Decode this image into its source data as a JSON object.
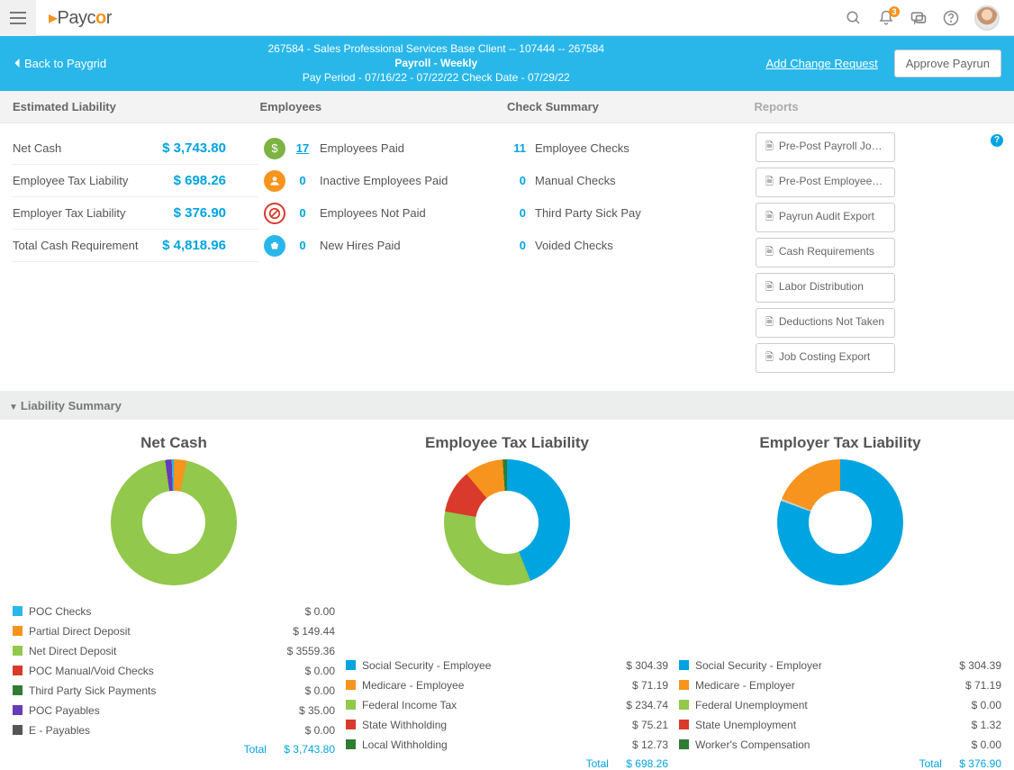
{
  "topbar": {
    "logo": "Paycor",
    "notifications_badge": "3"
  },
  "banner": {
    "back_label": "Back to Paygrid",
    "line1": "267584 - Sales Professional Services Base Client -- 107444 -- 267584",
    "line2": "Payroll - Weekly",
    "line3": "Pay Period - 07/16/22 - 07/22/22    Check Date - 07/29/22",
    "change_request": "Add Change Request",
    "approve": "Approve Payrun"
  },
  "headers": {
    "est": "Estimated Liability",
    "emp": "Employees",
    "chk": "Check Summary",
    "rep": "Reports"
  },
  "est_liability": [
    {
      "label": "Net Cash",
      "value": "$ 3,743.80"
    },
    {
      "label": "Employee Tax Liability",
      "value": "$ 698.26"
    },
    {
      "label": "Employer Tax Liability",
      "value": "$ 376.90"
    },
    {
      "label": "Total Cash Requirement",
      "value": "$ 4,818.96"
    }
  ],
  "employees": [
    {
      "num": "17",
      "label": "Employees Paid",
      "link": true
    },
    {
      "num": "0",
      "label": "Inactive Employees Paid",
      "link": false
    },
    {
      "num": "0",
      "label": "Employees Not Paid",
      "link": false
    },
    {
      "num": "0",
      "label": "New Hires Paid",
      "link": false
    }
  ],
  "check_summary": [
    {
      "num": "11",
      "label": "Employee Checks"
    },
    {
      "num": "0",
      "label": "Manual Checks"
    },
    {
      "num": "0",
      "label": "Third Party Sick Pay"
    },
    {
      "num": "0",
      "label": "Voided Checks"
    }
  ],
  "reports": [
    "Pre-Post Payroll Journal",
    "Pre-Post Employee Exp...",
    "Payrun Audit Export",
    "Cash Requirements",
    "Labor Distribution",
    "Deductions Not Taken",
    "Job Costing Export"
  ],
  "liability_summary_label": "Liability Summary",
  "chart_data": [
    {
      "type": "pie",
      "title": "Net Cash",
      "series": [
        {
          "name": "POC Checks",
          "value": 0.0,
          "color": "#29b7ea"
        },
        {
          "name": "Partial Direct Deposit",
          "value": 149.44,
          "color": "#f7941d"
        },
        {
          "name": "Net Direct Deposit",
          "value": 3559.36,
          "color": "#92c84b"
        },
        {
          "name": "POC Manual/Void Checks",
          "value": 0.0,
          "color": "#d93a2b"
        },
        {
          "name": "Third Party Sick Payments",
          "value": 0.0,
          "color": "#2e7d32"
        },
        {
          "name": "POC Payables",
          "value": 35.0,
          "color": "#673ab7"
        },
        {
          "name": "E - Payables",
          "value": 0.0,
          "color": "#555555"
        }
      ],
      "total_label": "Total",
      "total_value": "$ 3,743.80"
    },
    {
      "type": "pie",
      "title": "Employee Tax Liability",
      "series": [
        {
          "name": "Social Security - Employee",
          "value": 304.39,
          "color": "#00a4e0"
        },
        {
          "name": "Medicare - Employee",
          "value": 71.19,
          "color": "#f7941d"
        },
        {
          "name": "Federal Income Tax",
          "value": 234.74,
          "color": "#92c84b"
        },
        {
          "name": "State Withholding",
          "value": 75.21,
          "color": "#d93a2b"
        },
        {
          "name": "Local Withholding",
          "value": 12.73,
          "color": "#2e7d32"
        }
      ],
      "total_label": "Total",
      "total_value": "$ 698.26"
    },
    {
      "type": "pie",
      "title": "Employer Tax Liability",
      "series": [
        {
          "name": "Social Security - Employer",
          "value": 304.39,
          "color": "#00a4e0"
        },
        {
          "name": "Medicare - Employer",
          "value": 71.19,
          "color": "#f7941d"
        },
        {
          "name": "Federal Unemployment",
          "value": 0.0,
          "color": "#92c84b"
        },
        {
          "name": "State Unemployment",
          "value": 1.32,
          "color": "#d93a2b"
        },
        {
          "name": "Worker's Compensation",
          "value": 0.0,
          "color": "#2e7d32"
        }
      ],
      "total_label": "Total",
      "total_value": "$ 376.90"
    }
  ]
}
